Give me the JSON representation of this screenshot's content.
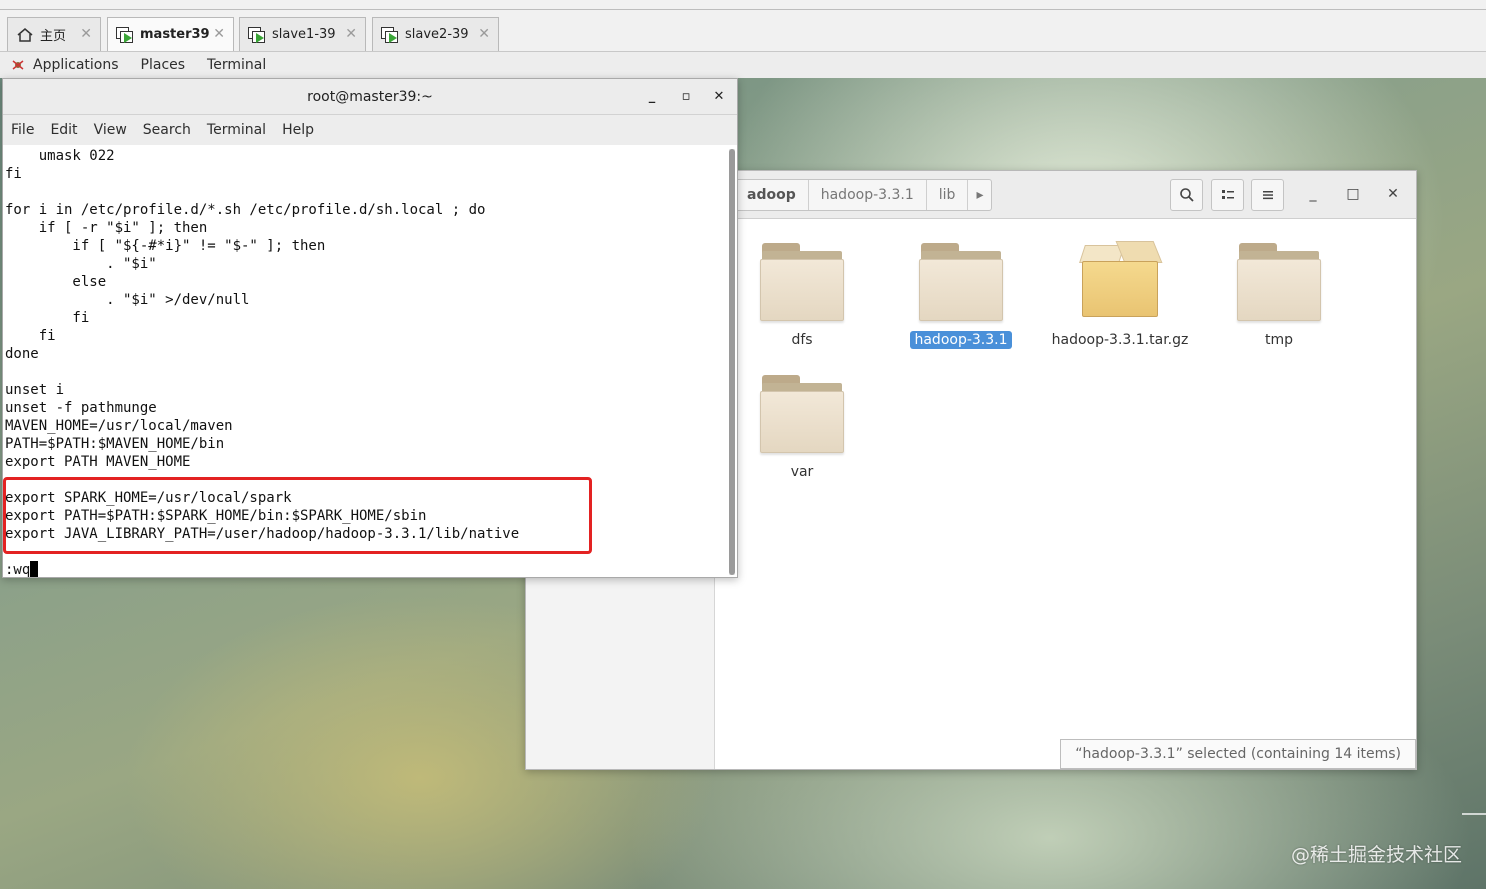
{
  "vm_tabs": [
    {
      "label": "主页",
      "icon": "home-icon"
    },
    {
      "label": "master39",
      "icon": "vm-running-icon"
    },
    {
      "label": "slave1-39",
      "icon": "vm-running-icon"
    },
    {
      "label": "slave2-39",
      "icon": "vm-running-icon"
    }
  ],
  "gnome_bar": {
    "applications": "Applications",
    "places": "Places",
    "terminal": "Terminal"
  },
  "terminal": {
    "title": "root@master39:~",
    "menu": [
      "File",
      "Edit",
      "View",
      "Search",
      "Terminal",
      "Help"
    ],
    "lines": [
      "    umask 022",
      "fi",
      "",
      "for i in /etc/profile.d/*.sh /etc/profile.d/sh.local ; do",
      "    if [ -r \"$i\" ]; then",
      "        if [ \"${-#*i}\" != \"$-\" ]; then",
      "            . \"$i\"",
      "        else",
      "            . \"$i\" >/dev/null",
      "        fi",
      "    fi",
      "done",
      "",
      "unset i",
      "unset -f pathmunge",
      "MAVEN_HOME=/usr/local/maven",
      "PATH=$PATH:$MAVEN_HOME/bin",
      "export PATH MAVEN_HOME",
      "",
      "export SPARK_HOME=/usr/local/spark",
      "export PATH=$PATH:$SPARK_HOME/bin:$SPARK_HOME/sbin",
      "export JAVA_LIBRARY_PATH=/user/hadoop/hadoop-3.3.1/lib/native",
      ""
    ],
    "command_line": ":wq"
  },
  "file_manager": {
    "breadcrumbs": [
      "adoop",
      "hadoop-3.3.1",
      "lib"
    ],
    "items": [
      {
        "name": "dfs",
        "type": "folder",
        "selected": false
      },
      {
        "name": "hadoop-3.3.1",
        "type": "folder",
        "selected": true
      },
      {
        "name": "hadoop-3.3.1.tar.gz",
        "type": "archive",
        "selected": false
      },
      {
        "name": "tmp",
        "type": "folder",
        "selected": false
      },
      {
        "name": "var",
        "type": "folder",
        "selected": false
      }
    ],
    "status": "“hadoop-3.3.1” selected  (containing 14 items)"
  },
  "watermark": "@稀土掘金技术社区",
  "colors": {
    "selection": "#4a90d9",
    "highlight_box": "#e32222"
  }
}
